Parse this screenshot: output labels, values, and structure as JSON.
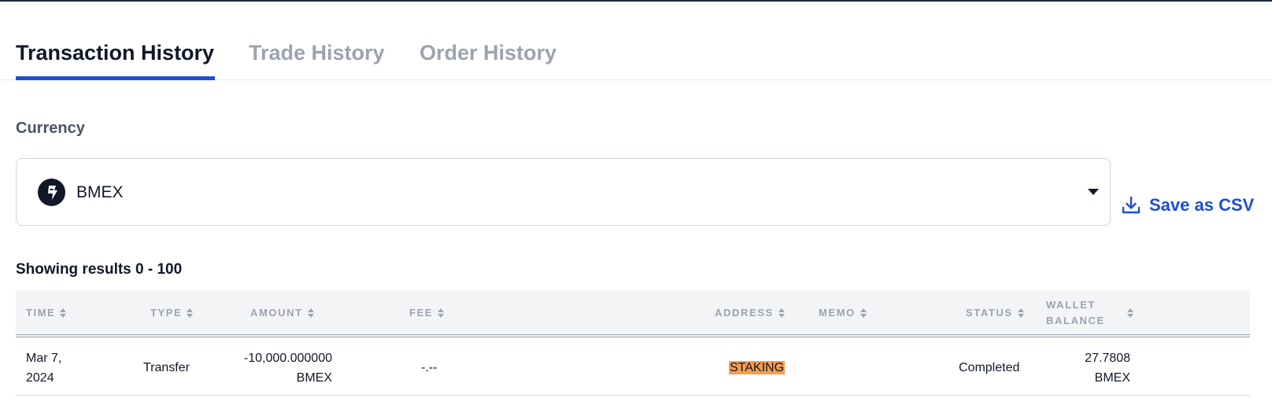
{
  "tabs": [
    {
      "label": "Transaction History",
      "active": true
    },
    {
      "label": "Trade History",
      "active": false
    },
    {
      "label": "Order History",
      "active": false
    }
  ],
  "currency": {
    "label": "Currency",
    "selected": "BMEX",
    "icon": "bmex-coin-icon"
  },
  "actions": {
    "save_csv_label": "Save as CSV",
    "save_csv_icon": "download-icon"
  },
  "results_text": "Showing results 0 - 100",
  "table": {
    "columns": [
      "TIME",
      "TYPE",
      "AMOUNT",
      "FEE",
      "ADDRESS",
      "MEMO",
      "STATUS",
      "WALLET",
      "BALANCE"
    ],
    "rows": [
      {
        "time_date": "Mar 7,",
        "time_year": "2024",
        "type": "Transfer",
        "amount_value": "-10,000.000000",
        "amount_unit": "BMEX",
        "fee": "-.--",
        "address": "STAKING",
        "memo": "",
        "status": "Completed",
        "balance_value": "27.7808",
        "balance_unit": "BMEX"
      }
    ]
  },
  "colors": {
    "accent": "#1d4ed8",
    "tab_inactive": "#9ca3af",
    "badge_staking": "#f59e4b",
    "header_bg": "#f3f4f6"
  }
}
